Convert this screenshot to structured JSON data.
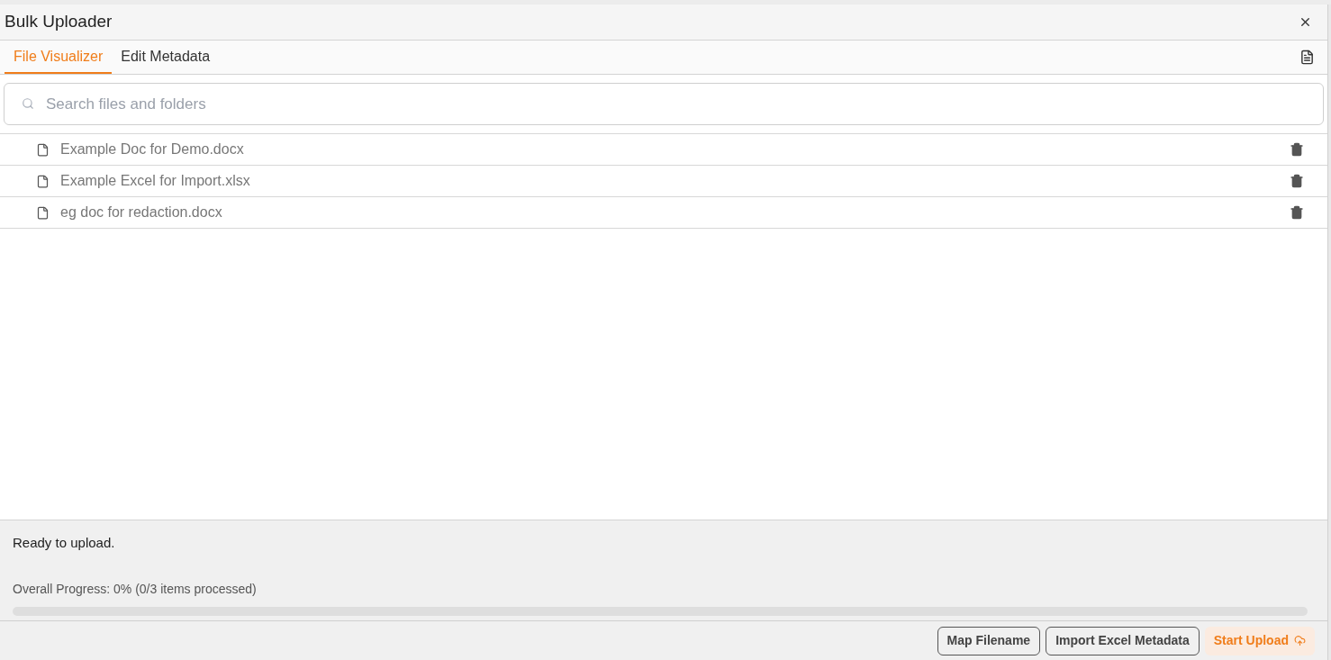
{
  "window": {
    "title": "Bulk Uploader"
  },
  "tabs": [
    {
      "label": "File Visualizer",
      "selected": true
    },
    {
      "label": "Edit Metadata",
      "selected": false
    }
  ],
  "search": {
    "placeholder": "Search files and folders"
  },
  "files": [
    {
      "name": "Example Doc for Demo.docx"
    },
    {
      "name": "Example Excel for Import.xlsx"
    },
    {
      "name": "eg doc for redaction.docx"
    }
  ],
  "status": {
    "message": "Ready to upload.",
    "progress_label": "Overall Progress: 0% (0/3 items processed)",
    "level": 0
  },
  "buttons": [
    {
      "label": "Map Filename",
      "kind": "outline"
    },
    {
      "label": "Import Excel Metadata",
      "kind": "outline"
    },
    {
      "label": "Start Upload",
      "kind": "primary"
    }
  ]
}
